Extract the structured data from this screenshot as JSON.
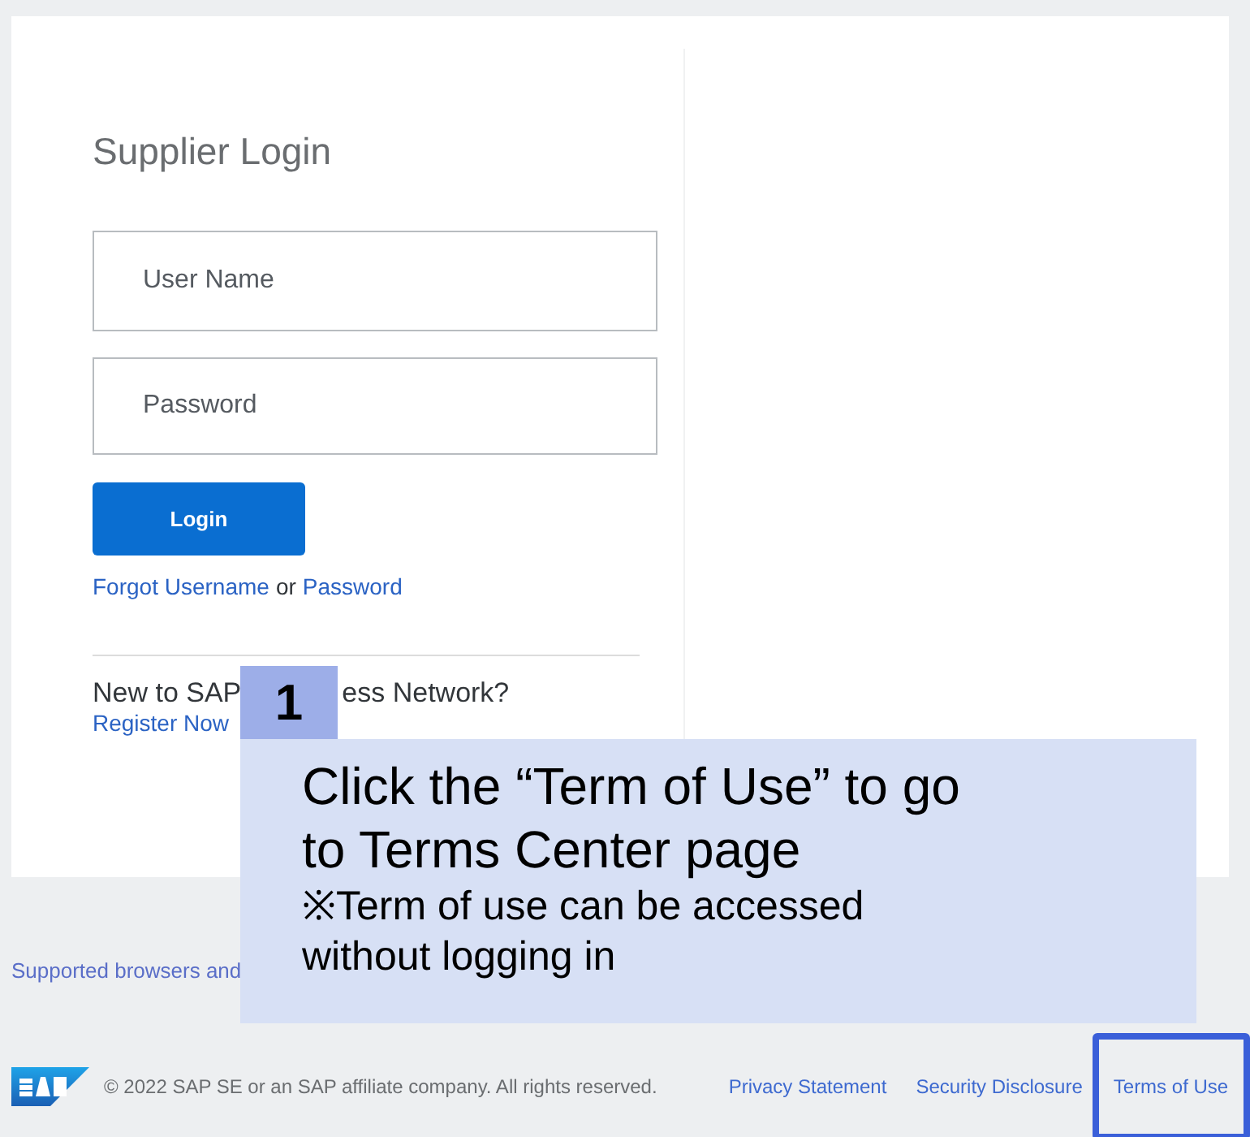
{
  "login": {
    "title": "Supplier Login",
    "fields": [
      {
        "placeholder": "User Name"
      },
      {
        "placeholder": "Password"
      }
    ],
    "button": "Login",
    "forgot": {
      "username_link": "Forgot Username",
      "separator": "or",
      "password_link": "Password"
    }
  },
  "register": {
    "heading_parts": [
      "New to SAP",
      "ess Network?"
    ],
    "link": "Register Now"
  },
  "supported_link": "Supported browsers and",
  "callout": {
    "step": "1",
    "text": "Click the “Term of Use” to go to Terms Center page",
    "note": "※Term of use can be accessed without logging in"
  },
  "footer": {
    "copyright": "© 2022 SAP SE or an SAP affiliate company. All rights reserved.",
    "links": [
      {
        "label": "Privacy Statement",
        "highlighted": false
      },
      {
        "label": "Security Disclosure",
        "highlighted": false
      },
      {
        "label": "Terms of Use",
        "highlighted": true
      }
    ]
  }
}
